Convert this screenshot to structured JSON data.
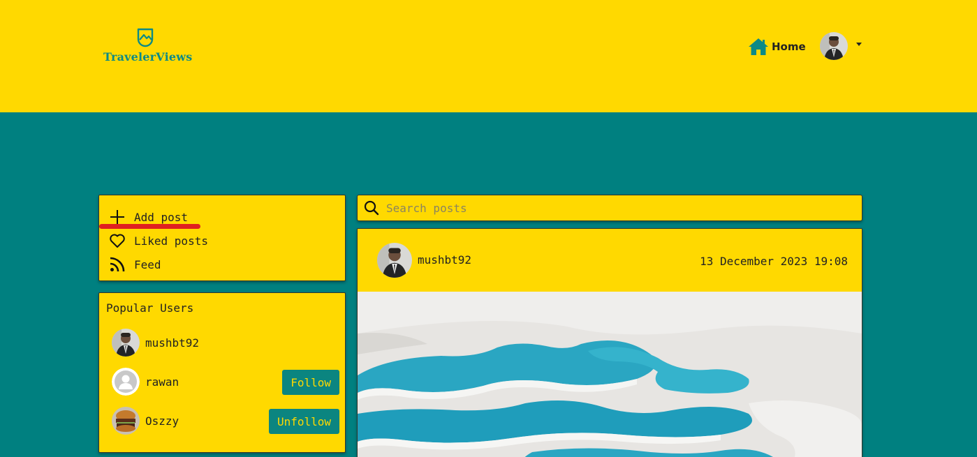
{
  "brand": {
    "name": "TravelerViews"
  },
  "nav": {
    "home_label": "Home"
  },
  "sidebar": {
    "menu": [
      {
        "label": "Add post",
        "icon": "plus-icon"
      },
      {
        "label": "Liked posts",
        "icon": "heart-icon"
      },
      {
        "label": "Feed",
        "icon": "rss-icon"
      }
    ],
    "popular": {
      "title": "Popular Users",
      "users": [
        {
          "name": "mushbt92",
          "button": ""
        },
        {
          "name": "rawan",
          "button": "Follow"
        },
        {
          "name": "Oszzy",
          "button": "Unfollow"
        }
      ]
    }
  },
  "search": {
    "placeholder": "Search posts",
    "value": ""
  },
  "post": {
    "author": "mushbt92",
    "date": "13 December 2023 19:08"
  },
  "colors": {
    "primary_yellow": "#ffd900",
    "teal": "#008080",
    "button_teal": "#0b8580",
    "highlight_red": "#e02020"
  }
}
